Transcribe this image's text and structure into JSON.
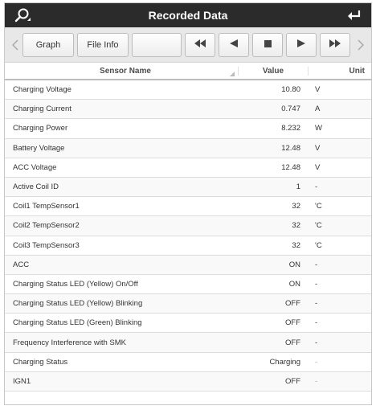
{
  "header": {
    "title": "Recorded Data",
    "search_icon": "search-icon",
    "back_icon": "return-arrow-icon",
    "bg": "#2b2b2b"
  },
  "toolbar": {
    "graph_label": "Graph",
    "fileinfo_label": "File Info",
    "icons": [
      "fast-rewind-icon",
      "play-reverse-icon",
      "stop-icon",
      "play-icon",
      "fast-forward-icon"
    ]
  },
  "table": {
    "headers": {
      "name": "Sensor Name",
      "value": "Value",
      "unit": "Unit"
    },
    "rows": [
      {
        "name": "Charging Voltage",
        "value": "10.80",
        "unit": "V"
      },
      {
        "name": "Charging Current",
        "value": "0.747",
        "unit": "A"
      },
      {
        "name": "Charging Power",
        "value": "8.232",
        "unit": "W"
      },
      {
        "name": "Battery Voltage",
        "value": "12.48",
        "unit": "V"
      },
      {
        "name": "ACC Voltage",
        "value": "12.48",
        "unit": "V"
      },
      {
        "name": "Active Coil ID",
        "value": "1",
        "unit": "-"
      },
      {
        "name": "Coil1 TempSensor1",
        "value": "32",
        "unit": "'C"
      },
      {
        "name": "Coil2 TempSensor2",
        "value": "32",
        "unit": "'C"
      },
      {
        "name": "Coil3 TempSensor3",
        "value": "32",
        "unit": "'C"
      },
      {
        "name": "ACC",
        "value": "ON",
        "unit": "-"
      },
      {
        "name": "Charging Status LED (Yellow) On/Off",
        "value": "ON",
        "unit": "-"
      },
      {
        "name": "Charging Status LED (Yellow) Blinking",
        "value": "OFF",
        "unit": "-"
      },
      {
        "name": "Charging Status LED (Green) Blinking",
        "value": "OFF",
        "unit": "-"
      },
      {
        "name": "Frequency Interference with SMK",
        "value": "OFF",
        "unit": "-"
      },
      {
        "name": "Charging Status",
        "value": "Charging",
        "unit": "-"
      },
      {
        "name": "IGN1",
        "value": "OFF",
        "unit": "-"
      }
    ]
  }
}
